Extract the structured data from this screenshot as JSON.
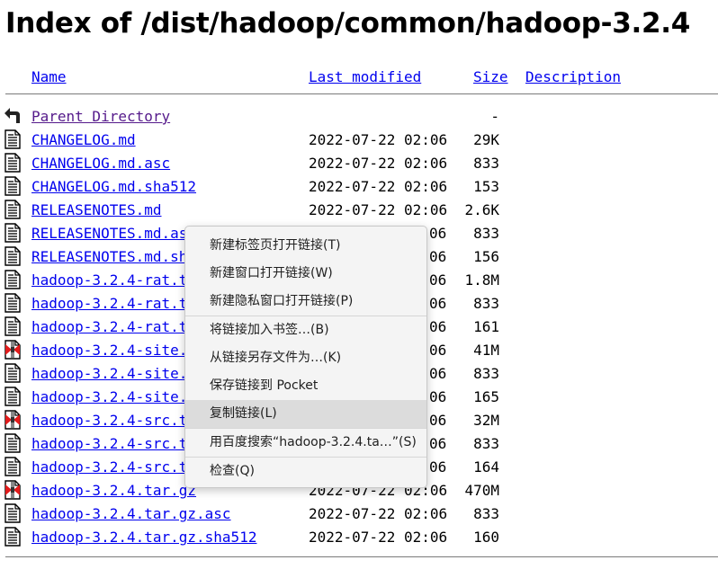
{
  "page": {
    "title": "Index of /dist/hadoop/common/hadoop-3.2.4"
  },
  "columns": {
    "name": "Name",
    "last_modified": "Last modified",
    "size": "Size",
    "description": "Description"
  },
  "rows": [
    {
      "name": "Parent Directory",
      "date": "",
      "size": "-",
      "icon": "back-icon"
    },
    {
      "name": "CHANGELOG.md",
      "date": "2022-07-22 02:06",
      "size": "29K",
      "icon": "text-file-icon"
    },
    {
      "name": "CHANGELOG.md.asc",
      "date": "2022-07-22 02:06",
      "size": "833",
      "icon": "text-file-icon"
    },
    {
      "name": "CHANGELOG.md.sha512",
      "date": "2022-07-22 02:06",
      "size": "153",
      "icon": "text-file-icon"
    },
    {
      "name": "RELEASENOTES.md",
      "date": "2022-07-22 02:06",
      "size": "2.6K",
      "icon": "text-file-icon"
    },
    {
      "name": "RELEASENOTES.md.as",
      "date": "06",
      "size": "833",
      "icon": "text-file-icon"
    },
    {
      "name": "RELEASENOTES.md.sh",
      "date": "06",
      "size": "156",
      "icon": "text-file-icon"
    },
    {
      "name": "hadoop-3.2.4-rat.t",
      "date": "06",
      "size": "1.8M",
      "icon": "text-file-icon"
    },
    {
      "name": "hadoop-3.2.4-rat.t",
      "date": "06",
      "size": "833",
      "icon": "text-file-icon"
    },
    {
      "name": "hadoop-3.2.4-rat.t",
      "date": "06",
      "size": "161",
      "icon": "text-file-icon"
    },
    {
      "name": "hadoop-3.2.4-site.",
      "date": "06",
      "size": "41M",
      "icon": "compressed-file-icon"
    },
    {
      "name": "hadoop-3.2.4-site.",
      "date": "06",
      "size": "833",
      "icon": "text-file-icon"
    },
    {
      "name": "hadoop-3.2.4-site.",
      "date": "06",
      "size": "165",
      "icon": "text-file-icon"
    },
    {
      "name": "hadoop-3.2.4-src.t",
      "date": "06",
      "size": "32M",
      "icon": "compressed-file-icon"
    },
    {
      "name": "hadoop-3.2.4-src.t",
      "date": "06",
      "size": "833",
      "icon": "text-file-icon"
    },
    {
      "name": "hadoop-3.2.4-src.t",
      "date": "06",
      "size": "164",
      "icon": "text-file-icon"
    },
    {
      "name": "hadoop-3.2.4.tar.gz",
      "date": "2022-07-22 02:06",
      "size": "470M",
      "icon": "compressed-file-icon"
    },
    {
      "name": "hadoop-3.2.4.tar.gz.asc",
      "date": "2022-07-22 02:06",
      "size": "833",
      "icon": "text-file-icon"
    },
    {
      "name": "hadoop-3.2.4.tar.gz.sha512",
      "date": "2022-07-22 02:06",
      "size": "160",
      "icon": "text-file-icon"
    }
  ],
  "context_menu": {
    "items": [
      "新建标签页打开链接(T)",
      "新建窗口打开链接(W)",
      "新建隐私窗口打开链接(P)",
      "将链接加入书签…(B)",
      "从链接另存文件为…(K)",
      "保存链接到 Pocket",
      "复制链接(L)",
      "用百度搜索“hadoop-3.2.4.ta…”(S)",
      "检查(Q)"
    ],
    "highlighted_index": 6
  },
  "colors": {
    "link": "#0000ee",
    "visited": "#551a8b",
    "menu_bg": "#f4f4f4",
    "menu_highlight": "#dcdcdc"
  }
}
